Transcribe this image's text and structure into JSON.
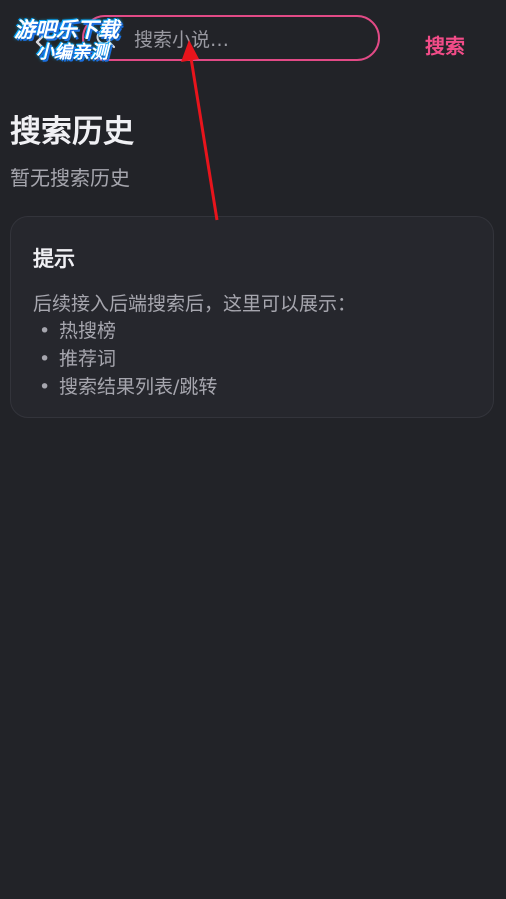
{
  "header": {
    "search_placeholder": "搜索小说…",
    "search_button_label": "搜索",
    "accent_color": "#e24a86"
  },
  "watermark": {
    "line1": "游吧乐下载",
    "line2": "小编亲测"
  },
  "history": {
    "title": "搜索历史",
    "empty_text": "暂无搜索历史"
  },
  "tip": {
    "title": "提示",
    "description": "后续接入后端搜索后，这里可以展示：",
    "bullet": "•",
    "items": [
      {
        "label": "热搜榜"
      },
      {
        "label": "推荐词"
      },
      {
        "label": "搜索结果列表/跳转"
      }
    ]
  },
  "annotation": {
    "arrow_color": "#e8141c"
  }
}
